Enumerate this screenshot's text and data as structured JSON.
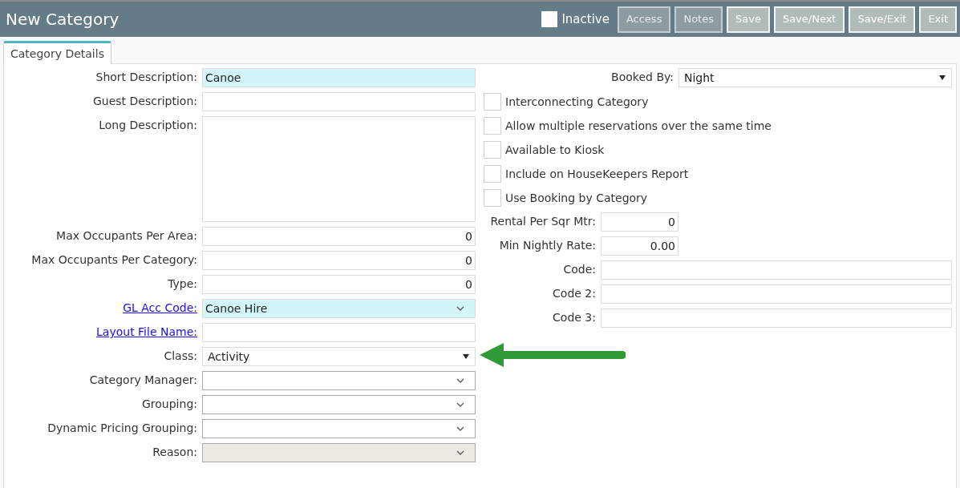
{
  "window": {
    "title": "New Category"
  },
  "inactive": {
    "label": "Inactive",
    "checked": false
  },
  "buttons": [
    {
      "label": "Access",
      "disabled": true
    },
    {
      "label": "Notes",
      "disabled": true
    },
    {
      "label": "Save",
      "disabled": false
    },
    {
      "label": "Save/Next",
      "disabled": false
    },
    {
      "label": "Save/Exit",
      "disabled": false
    },
    {
      "label": "Exit",
      "disabled": false
    }
  ],
  "tabs": [
    {
      "label": "Category Details",
      "selected": true
    }
  ],
  "left_fields": [
    {
      "label": "Short Description:",
      "kind": "text",
      "value": "Canoe",
      "highlight": true,
      "link": false,
      "disabled": false
    },
    {
      "label": "Guest Description:",
      "kind": "text",
      "highlight": false,
      "link": false,
      "disabled": false
    },
    {
      "label": "Long Description:",
      "kind": "textarea",
      "highlight": false,
      "link": false,
      "disabled": false
    },
    {
      "label": "Max Occupants Per Area:",
      "kind": "number",
      "value": "0",
      "highlight": false,
      "link": false,
      "disabled": false
    },
    {
      "label": "Max Occupants Per Category:",
      "kind": "number",
      "value": "0",
      "highlight": false,
      "link": false,
      "disabled": false
    },
    {
      "label": "Type:",
      "kind": "number",
      "value": "0",
      "highlight": false,
      "link": false,
      "disabled": false
    },
    {
      "label": "GL Acc Code:",
      "kind": "select",
      "value": "Canoe Hire",
      "highlight": true,
      "link": true,
      "disabled": false
    },
    {
      "label": "Layout File Name:",
      "kind": "text",
      "highlight": false,
      "link": true,
      "disabled": false
    },
    {
      "label": "Class:",
      "kind": "dropdown",
      "value": "Activity",
      "highlight": false,
      "link": false,
      "disabled": false
    },
    {
      "label": "Category Manager:",
      "kind": "select",
      "highlight": false,
      "link": false,
      "disabled": false
    },
    {
      "label": "Grouping:",
      "kind": "select",
      "highlight": false,
      "link": false,
      "disabled": false
    },
    {
      "label": "Dynamic Pricing Grouping:",
      "kind": "select",
      "highlight": false,
      "link": false,
      "disabled": false
    },
    {
      "label": "Reason:",
      "kind": "select",
      "highlight": false,
      "link": false,
      "disabled": true
    }
  ],
  "right_fields": [
    {
      "label": "Booked By:",
      "kind": "dropdown",
      "value": "Night"
    },
    {
      "label": "Interconnecting Category",
      "kind": "checkbox",
      "checked": false
    },
    {
      "label": "Allow multiple reservations over the same time",
      "kind": "checkbox",
      "checked": false
    },
    {
      "label": "Available to Kiosk",
      "kind": "checkbox",
      "checked": false
    },
    {
      "label": "Include on HouseKeepers Report",
      "kind": "checkbox",
      "checked": false
    },
    {
      "label": "Use Booking by Category",
      "kind": "checkbox",
      "checked": false
    },
    {
      "label": "Rental Per Sqr Mtr:",
      "kind": "number",
      "value": "0"
    },
    {
      "label": "Min Nightly Rate:",
      "kind": "number",
      "value": "0.00"
    },
    {
      "label": "Code:",
      "kind": "text"
    },
    {
      "label": "Code 2:",
      "kind": "text"
    },
    {
      "label": "Code 3:",
      "kind": "text"
    }
  ]
}
